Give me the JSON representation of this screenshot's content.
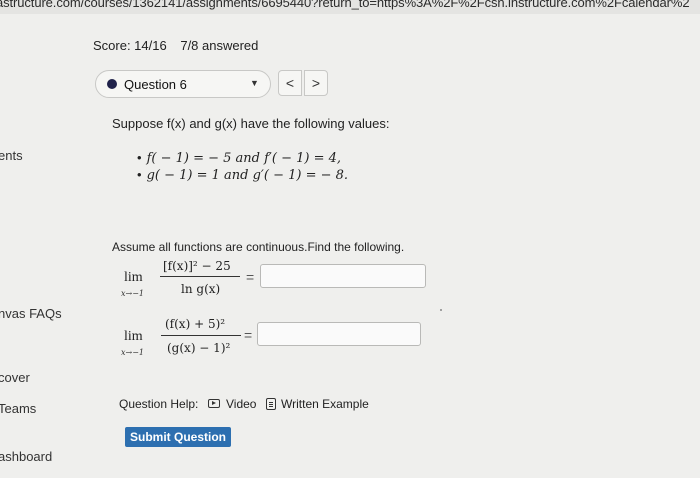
{
  "browser": {
    "url_main": "astructure.com/courses/1362141/assignments/6695440?return_to=https%3A%2F%2Fcsn.instructure.com%2Fcalendar%2"
  },
  "sidebar": [
    {
      "label": "ents"
    },
    {
      "label": "nvas FAQs"
    },
    {
      "label": "cover"
    },
    {
      "label": "Teams"
    },
    {
      "label": "ashboard"
    }
  ],
  "header": {
    "score": "Score: 14/16",
    "answered": "7/8 answered"
  },
  "question_select": {
    "selected": "Question 6",
    "prev": "<",
    "next": ">"
  },
  "problem": {
    "stem": "Suppose f(x) and g(x) have the following values:",
    "bullets": [
      "f( − 1) = − 5 and f′( − 1) = 4,",
      "g( − 1) = 1 and g′( − 1) = − 8."
    ],
    "instruction": "Assume all functions are continuous.Find the following.",
    "limits": [
      {
        "lim": "lim",
        "sub": "x→−1",
        "num": "[f(x)]² − 25",
        "den": "ln g(x)",
        "eq": "=",
        "answer": ""
      },
      {
        "lim": "lim",
        "sub": "x→−1",
        "num": "(f(x) + 5)²",
        "den": "(g(x) − 1)²",
        "eq": "=",
        "answer": ""
      }
    ]
  },
  "help": {
    "label": "Question Help:",
    "video": "Video",
    "written": "Written Example"
  },
  "submit_label": "Submit Question"
}
